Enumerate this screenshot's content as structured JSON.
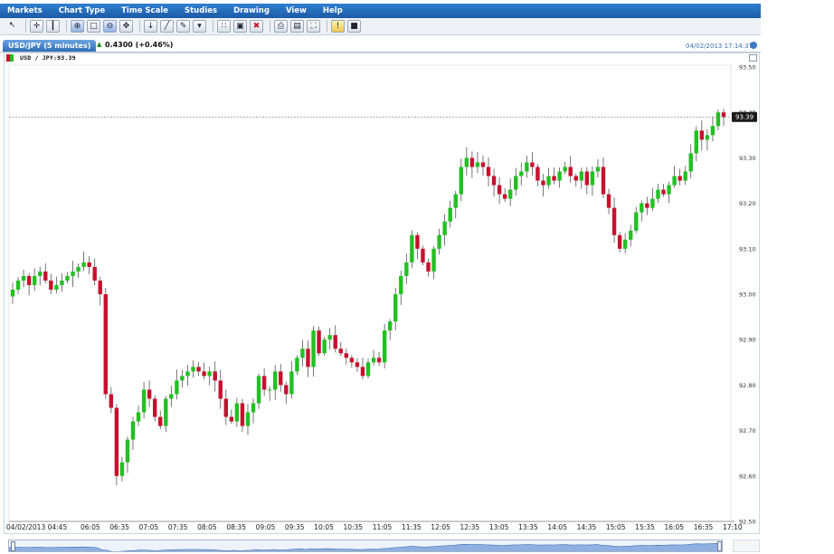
{
  "menu": {
    "items": [
      "Markets",
      "Chart Type",
      "Time Scale",
      "Studies",
      "Drawing",
      "View",
      "Help"
    ]
  },
  "toolbar": {
    "icons": [
      "cursor-icon",
      "crosshair-icon",
      "candlestick-icon",
      "zoom-in-icon",
      "zoom-area-icon",
      "zoom-out-icon",
      "pan-icon",
      "marker-icon",
      "trendline-icon",
      "pencil-icon",
      "dropdown-icon",
      "grid-icon",
      "select-icon",
      "delete-icon",
      "print-icon",
      "export-icon",
      "fullscreen-icon",
      "info-icon",
      "save-icon"
    ]
  },
  "tab": {
    "label": "USD/JPY (5 minutes)",
    "change": "0.4300 (+0.46%)",
    "timestamp": "04/02/2013 17:14:37"
  },
  "legend": {
    "text": "USD / JPY:93.39"
  },
  "colors": {
    "up": "#22c022",
    "down": "#c8102e",
    "accent": "#1d5aa6"
  },
  "chart_data": {
    "type": "candlestick",
    "ylim": [
      92.5,
      93.5
    ],
    "yticks": [
      "93.50",
      "93.40",
      "93.30",
      "93.20",
      "93.10",
      "93.00",
      "92.90",
      "92.80",
      "92.70",
      "92.60",
      "92.50"
    ],
    "xticks": [
      "04/02/2013 04:45",
      "06:05",
      "06:35",
      "07:05",
      "07:35",
      "08:05",
      "08:35",
      "09:05",
      "09:35",
      "10:05",
      "10:35",
      "11:05",
      "11:35",
      "12:05",
      "12:35",
      "13:05",
      "13:35",
      "14:05",
      "14:35",
      "15:05",
      "15:35",
      "16:05",
      "16:35",
      "17:10"
    ],
    "last_price": 93.39,
    "last_price_label": "93.39",
    "close": [
      93.01,
      93.03,
      93.04,
      93.02,
      93.04,
      93.05,
      93.03,
      93.01,
      93.02,
      93.03,
      93.04,
      93.05,
      93.06,
      93.07,
      93.06,
      93.03,
      93.0,
      92.78,
      92.75,
      92.6,
      92.63,
      92.68,
      92.72,
      92.74,
      92.79,
      92.77,
      92.73,
      92.71,
      92.77,
      92.78,
      92.81,
      92.82,
      92.83,
      92.84,
      92.83,
      92.82,
      92.83,
      92.81,
      92.77,
      92.73,
      92.72,
      92.76,
      92.71,
      92.74,
      92.76,
      92.82,
      92.79,
      92.79,
      92.83,
      92.8,
      92.78,
      92.83,
      92.86,
      92.88,
      92.84,
      92.92,
      92.87,
      92.9,
      92.91,
      92.88,
      92.87,
      92.86,
      92.85,
      92.84,
      92.82,
      92.85,
      92.86,
      92.85,
      92.92,
      92.94,
      93.0,
      93.04,
      93.07,
      93.13,
      93.1,
      93.07,
      93.05,
      93.1,
      93.13,
      93.16,
      93.19,
      93.22,
      93.28,
      93.3,
      93.28,
      93.29,
      93.28,
      93.26,
      93.24,
      93.22,
      93.21,
      93.23,
      93.26,
      93.27,
      93.29,
      93.28,
      93.25,
      93.24,
      93.26,
      93.25,
      93.27,
      93.28,
      93.26,
      93.25,
      93.27,
      93.24,
      93.27,
      93.28,
      93.22,
      93.19,
      93.13,
      93.1,
      93.12,
      93.14,
      93.18,
      93.2,
      93.19,
      93.21,
      93.23,
      93.22,
      93.24,
      93.26,
      93.25,
      93.27,
      93.31,
      93.36,
      93.34,
      93.35,
      93.37,
      93.4,
      93.39
    ]
  }
}
